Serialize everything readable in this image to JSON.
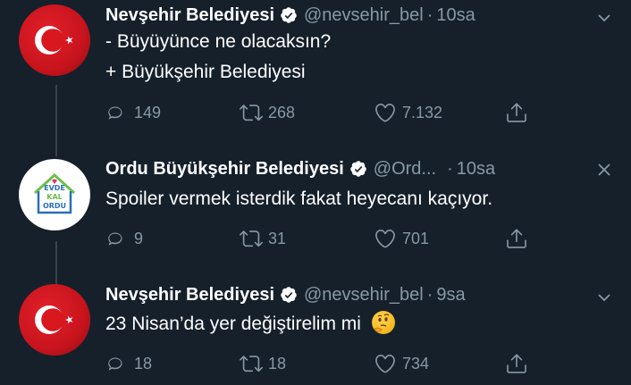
{
  "tweets": [
    {
      "name": "Nevşehir Belediyesi",
      "handle": "@nevsehir_bel",
      "sep": "·",
      "time": "10sa",
      "lines": [
        "- Büyüyünce ne olacaksın?",
        "+ Büyükşehir Belediyesi"
      ],
      "replies": "149",
      "retweets": "268",
      "likes": "7.132",
      "avatar": "turkish-flag-avatar",
      "menu_icon": "chevron-down-icon"
    },
    {
      "name": "Ordu Büyükşehir Belediyesi",
      "handle": "@Ord...",
      "sep": "·",
      "time": "10sa",
      "lines": [
        "Spoiler vermek isterdik fakat heyecanı kaçıyor."
      ],
      "replies": "9",
      "retweets": "31",
      "likes": "701",
      "avatar": "evde-kal-ordu-avatar",
      "avatar_text": [
        "EVDE",
        "KAL",
        "ORDU"
      ],
      "menu_icon": "close-icon"
    },
    {
      "name": "Nevşehir Belediyesi",
      "handle": "@nevsehir_bel",
      "sep": "·",
      "time": "9sa",
      "lines": [
        "23 Nisan’da yer değiştirelim mi"
      ],
      "emoji": "thinking-face-emoji",
      "replies": "18",
      "retweets": "18",
      "likes": "734",
      "avatar": "turkish-flag-avatar",
      "menu_icon": "chevron-down-icon"
    }
  ],
  "colors": {
    "background": "#15202b",
    "secondary_text": "#8899a6",
    "verified_blue": "#ffffff",
    "thread_line": "#38444d"
  }
}
